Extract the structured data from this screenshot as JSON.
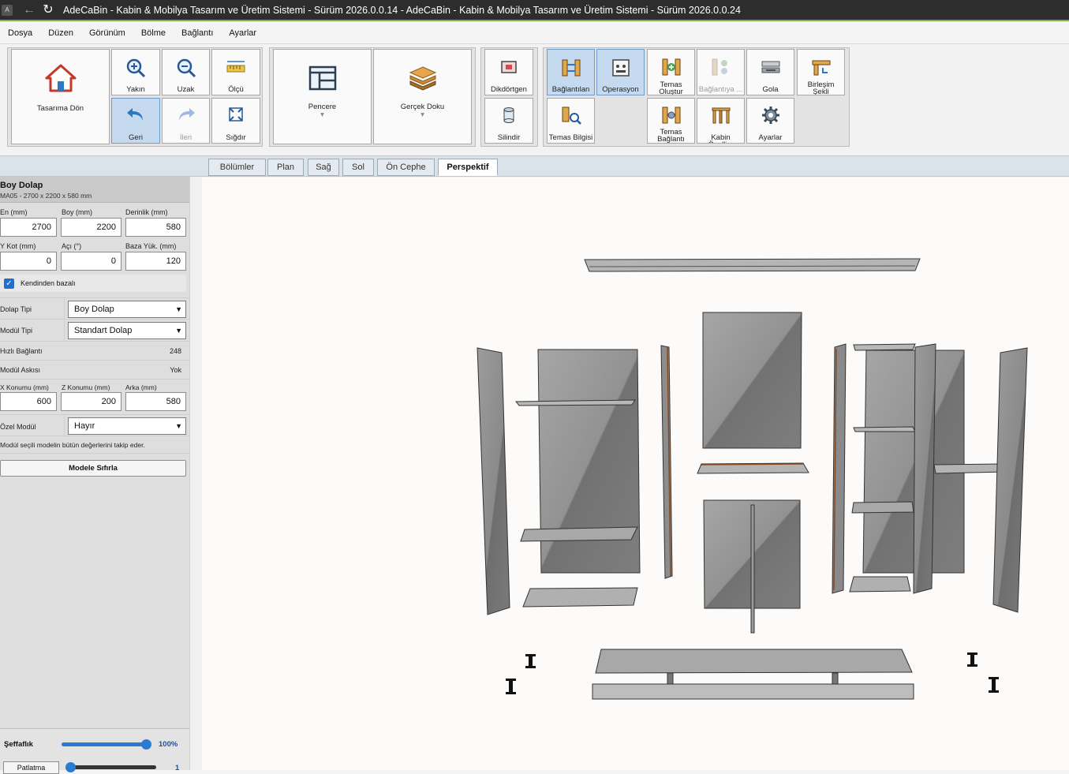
{
  "titlebar": {
    "app_icon": "A",
    "title": "AdeCaBin - Kabin & Mobilya Tasarım ve Üretim Sistemi - Sürüm 2026.0.0.14 - AdeCaBin - Kabin & Mobilya Tasarım ve Üretim Sistemi - Sürüm 2026.0.0.24"
  },
  "menu": [
    "Dosya",
    "Düzen",
    "Görünüm",
    "Bölme",
    "Bağlantı",
    "Ayarlar"
  ],
  "ribbon": {
    "home": "Tasarıma Dön",
    "zoom_in": "Yakın",
    "zoom_out": "Uzak",
    "measure": "Ölçü",
    "back": "Geri",
    "forward": "İleri",
    "fit": "Sığdır",
    "window": "Pencere",
    "texture": "Gerçek Doku",
    "rectangle": "Dikdörtgen",
    "cylinder": "Silindir",
    "connected": "Bağlantılan ...",
    "operation": "Operasyon ...",
    "contact_create": "Temas Oluştur",
    "connection_disabled": "Bağlantıya ...",
    "gola": "Gola",
    "join_shape": "Birleşim Şekli",
    "contact_info": "Temas Bilgisi",
    "contact_connection": "Temas Bağlantı",
    "cabin_props": "Kabin Özelli...",
    "settings": "Ayarlar"
  },
  "tabs": [
    "Bölümler",
    "Plan",
    "Sağ",
    "Sol",
    "Ön Cephe",
    "Perspektif"
  ],
  "panel": {
    "title": "Boy Dolap",
    "subtitle": "MA05 - 2700 x 2200 x 580 mm",
    "width_label": "En (mm)",
    "width": "2700",
    "height_label": "Boy (mm)",
    "height": "2200",
    "depth_label": "Derinlik (mm)",
    "depth": "580",
    "ykot_label": "Y Kot (mm)",
    "ykot": "0",
    "angle_label": "Açı (°)",
    "angle": "0",
    "base_label": "Baza Yük. (mm)",
    "base": "120",
    "self_base_label": "Kendinden bazalı",
    "cabinet_type_label": "Dolap Tipi",
    "cabinet_type": "Boy Dolap",
    "module_type_label": "Modül Tipi",
    "module_type": "Standart Dolap",
    "quick_conn_label": "Hızlı Bağlantı",
    "quick_conn": "248",
    "module_hanger_label": "Modül Askısı",
    "module_hanger": "Yok",
    "x_pos_label": "X Konumu (mm)",
    "x_pos": "600",
    "z_pos_label": "Z Konumu (mm)",
    "z_pos": "200",
    "back_label": "Arka (mm)",
    "back": "580",
    "special_label": "Özel Modül",
    "special": "Hayır",
    "note": "Modül seçili modelin bütün değerlerini takip eder.",
    "reset_button": "Modele Sıfırla"
  },
  "bottom": {
    "transparency_label": "Şeffaflık",
    "transparency_value": "100%",
    "transparency": 1.0,
    "explode_button": "Patlatma",
    "explode_value": "1"
  },
  "colors": {
    "accent": "#7fb24a",
    "active": "#c5daef",
    "title_bg": "#2d2d2d"
  }
}
